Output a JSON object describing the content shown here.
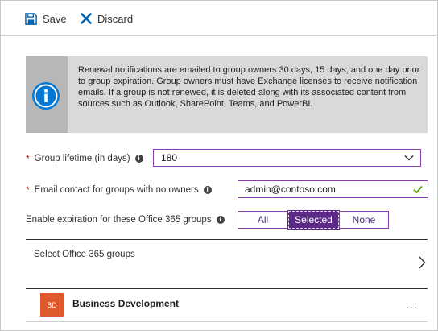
{
  "toolbar": {
    "save_label": "Save",
    "discard_label": "Discard"
  },
  "info": {
    "text": "Renewal notifications are emailed to group owners 30 days, 15 days, and one day prior to group expiration. Group owners must have Exchange licenses to receive notification emails. If a group is not renewed, it is deleted along with its associated content from sources such as Outlook, SharePoint, Teams, and PowerBI."
  },
  "form": {
    "lifetime": {
      "required_mark": "*",
      "label": "Group lifetime (in days)",
      "value": "180"
    },
    "email": {
      "required_mark": "*",
      "label": "Email contact for groups with no owners",
      "value": "admin@contoso.com"
    },
    "expiration": {
      "label": "Enable expiration for these Office 365 groups",
      "options": [
        "All",
        "Selected",
        "None"
      ],
      "selected": "Selected"
    }
  },
  "picker": {
    "label": "Select Office 365 groups"
  },
  "groups": [
    {
      "initials": "BD",
      "name": "Business Development",
      "more": "..."
    }
  ],
  "colors": {
    "accent": "#5b2a86",
    "border": "#8a3fae",
    "avatar": "#e0592d",
    "info_icon": "#0078d4",
    "required": "#a80000",
    "check": "#57a300"
  }
}
